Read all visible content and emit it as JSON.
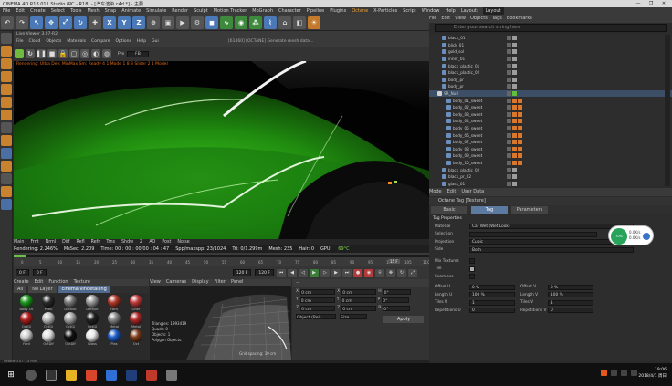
{
  "window": {
    "title": "CINEMA 4D R18.011 Studio (RC - R18) - [汽车渲染.c4d *] - 主要",
    "controls": [
      "—",
      "❐",
      "✕"
    ]
  },
  "menubar": [
    "File",
    "Edit",
    "Create",
    "Select",
    "Tools",
    "Mesh",
    "Snap",
    "Animate",
    "Simulate",
    "Render",
    "Sculpt",
    "Motion Tracker",
    "MoGraph",
    "Character",
    "Pipeline",
    "Plugins",
    "Octane",
    "X-Particles",
    "Script",
    "Window",
    "Help",
    "Layout:"
  ],
  "menubar_highlight": "Octane",
  "layout_value": "Layout",
  "toolbar": {
    "undo_icon": "↶",
    "axis_buttons": [
      "X",
      "Y",
      "Z"
    ]
  },
  "viewport": {
    "title": "Live Viewer 3.07-R2",
    "menu": [
      "File",
      "Cloud",
      "Objects",
      "Materials",
      "Compare",
      "Options",
      "Help",
      "Gui"
    ],
    "info": "[61460] [OCTANE] Generate mesh data...",
    "fps_label": "Pre",
    "fps_value": "FB",
    "render_overlay": "Rendering: Ultra Dev: MinMax Sm: Ready 4 1 Mode 1 8 3 Slider 2 1 Model",
    "bottom_modes": [
      "Main",
      "Frnt",
      "Nrml",
      "Diff",
      "Refl",
      "Refr",
      "Trns",
      "Shdw",
      "Z",
      "AO",
      "Post",
      "Noise"
    ],
    "stats": {
      "rendering": "Rendering: 2.246%",
      "msec": "MsSec: 2.209",
      "time": "Time: 00 : 00 : 00/00 : 04 : 47",
      "spp": "Spp/maxspp: 23/1024",
      "tri": "Tri: 0/1.299m",
      "mesh": "Mesh: 235",
      "hair": "Hair: 0",
      "gpu": "GPU:",
      "temp": "69°C"
    }
  },
  "timeline": {
    "ticks": [
      "0",
      "5",
      "10",
      "15",
      "20",
      "25",
      "30",
      "35",
      "40",
      "45",
      "50",
      "55",
      "60",
      "65",
      "70",
      "75",
      "80",
      "85",
      "90",
      "95",
      "100",
      "105",
      "110"
    ],
    "current_frame_box": "15 F",
    "start_frame": "0 F",
    "current_frame": "0 F",
    "end_frame": "120 F",
    "max_frame": "120 F",
    "progress": 0.03
  },
  "materials": {
    "menu": [
      "Create",
      "Edit",
      "Function",
      "Texture"
    ],
    "tabs": [
      "All",
      "No Layer",
      "cinema vindetailing"
    ],
    "active_tab": "cinema vindetailing",
    "items": [
      {
        "name": "Body Oc",
        "color": "#1f9a1f"
      },
      {
        "name": "Pneu",
        "color": "#2a2a2a"
      },
      {
        "name": "Default",
        "color": "#7a7a7a"
      },
      {
        "name": "Default",
        "color": "#9a9a9a"
      },
      {
        "name": "Fard",
        "color": "#b13a2a"
      },
      {
        "name": "Liner",
        "color": "#c03a3a"
      },
      {
        "name": "OctGl",
        "color": "#b02020"
      },
      {
        "name": "OctGl",
        "color": "#c0c0c0"
      },
      {
        "name": "OctGl",
        "color": "#a7a7a7"
      },
      {
        "name": "OctGl",
        "color": "#222222"
      },
      {
        "name": "Metal",
        "color": "#888888"
      },
      {
        "name": "Metal",
        "color": "#b02828"
      },
      {
        "name": "Fard",
        "color": "#d0d0d0"
      },
      {
        "name": "OctDif",
        "color": "#dddddd"
      },
      {
        "name": "OctDif",
        "color": "#111111"
      },
      {
        "name": "Glass",
        "color": "#e8e8e8"
      },
      {
        "name": "Plas",
        "color": "#1e5ec8"
      },
      {
        "name": "Oct",
        "color": "#7b3a1a"
      }
    ]
  },
  "texture_preview": {
    "menu": [
      "View",
      "Cameras",
      "Display",
      "Filter",
      "Panel"
    ],
    "info": [
      "Triangles: 1993419",
      "Quads: 0",
      "Objects: 1",
      "Polygon Objects:"
    ],
    "label": "Grid spacing: 10 cm"
  },
  "coordinates": {
    "position": {
      "x": "0 cm",
      "y": "0 cm",
      "z": "0 cm"
    },
    "size": {
      "x": "0 cm",
      "y": "0 cm",
      "z": "0 cm"
    },
    "rotation": {
      "h": "0°",
      "p": "0°",
      "b": "0°"
    },
    "mode": "Object (Rel)",
    "size_mode": "Size",
    "apply": "Apply"
  },
  "objects": {
    "menu": [
      "File",
      "Edit",
      "View",
      "Objects",
      "Tags",
      "Bookmarks"
    ],
    "search_placeholder": "Enter your search string here",
    "items": [
      {
        "name": "black_01",
        "indent": 2,
        "tags": 1
      },
      {
        "name": "blick_01",
        "indent": 2,
        "tags": 1
      },
      {
        "name": "gold_sol",
        "indent": 2,
        "tags": 1
      },
      {
        "name": "inner_01",
        "indent": 2,
        "tags": 1
      },
      {
        "name": "black_plastic_01",
        "indent": 2,
        "tags": 1
      },
      {
        "name": "black_plastic_02",
        "indent": 2,
        "tags": 1
      },
      {
        "name": "body_pr",
        "indent": 2,
        "tags": 1
      },
      {
        "name": "body_pr",
        "indent": 2,
        "tags": 1
      },
      {
        "name": "SR_Null",
        "indent": 1,
        "tags": 1,
        "selected": true
      },
      {
        "name": "body_01_sweet",
        "indent": 3,
        "tags": 2
      },
      {
        "name": "body_02_sweet",
        "indent": 3,
        "tags": 2
      },
      {
        "name": "body_03_sweet",
        "indent": 3,
        "tags": 2
      },
      {
        "name": "body_04_sweet",
        "indent": 3,
        "tags": 2
      },
      {
        "name": "body_05_sweet",
        "indent": 3,
        "tags": 2
      },
      {
        "name": "body_06_sweet",
        "indent": 3,
        "tags": 2
      },
      {
        "name": "body_07_sweet",
        "indent": 3,
        "tags": 2
      },
      {
        "name": "body_08_sweet",
        "indent": 3,
        "tags": 2
      },
      {
        "name": "body_09_sweet",
        "indent": 3,
        "tags": 2
      },
      {
        "name": "body_10_sweet",
        "indent": 3,
        "tags": 2
      },
      {
        "name": "black_plastic_02",
        "indent": 2,
        "tags": 1
      },
      {
        "name": "black_pr_02",
        "indent": 2,
        "tags": 1
      },
      {
        "name": "glass_01",
        "indent": 2,
        "tags": 1
      }
    ],
    "last": "world_alum_us"
  },
  "attributes": {
    "menu": [
      "Mode",
      "Edit",
      "User Data"
    ],
    "title": "Octane Tag [Texture]",
    "tabs": [
      "Basic",
      "Tag",
      "Parameters"
    ],
    "active_tab": "Tag",
    "section": "Tag Properties",
    "material_label": "Material",
    "material_value": "Car Wet (Wet Look)",
    "selection_label": "Selection",
    "projection_label": "Projection",
    "projection_value": "Cubic",
    "side_label": "Side",
    "side_value": "Both",
    "mix_label": "Mix Textures",
    "tile_label": "Tile",
    "seamless_label": "Seamless",
    "offset_u_label": "Offset U",
    "offset_u": "0 %",
    "offset_v_label": "Offset V",
    "offset_v": "0 %",
    "length_u_label": "Length U",
    "length_u": "100 %",
    "length_v_label": "Length V",
    "length_v": "100 %",
    "tiles_u_label": "Tiles U",
    "tiles_u": "1",
    "tiles_v_label": "Tiles V",
    "tiles_v": "1",
    "rep_u_label": "Repetitions U",
    "rep_u": "0",
    "rep_v_label": "Repetitions V",
    "rep_v": "0"
  },
  "badge": {
    "dot": "70%",
    "line1": "0.0K/s",
    "line2": "0.0K/s"
  },
  "status": "Octane 3.07: 14 min",
  "taskbar": {
    "clock_time": "19:06",
    "clock_date": "2018/4/1 周日"
  }
}
